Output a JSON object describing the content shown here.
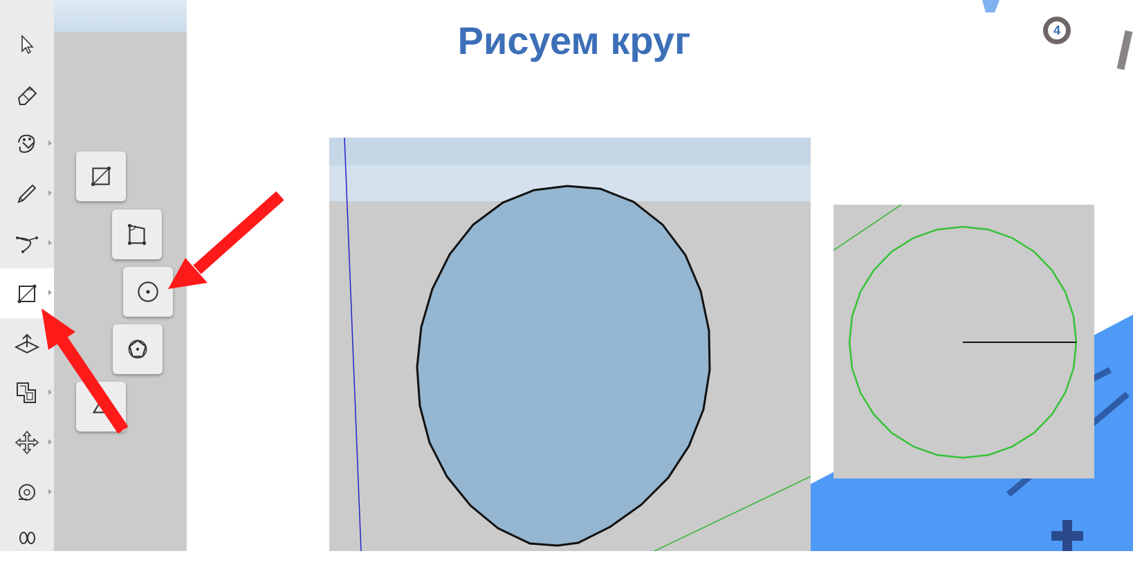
{
  "slide": {
    "title": "Рисуем круг",
    "number": "4"
  },
  "toolbar": {
    "tools": [
      {
        "name": "select-tool",
        "icon": "cursor-arrow-icon"
      },
      {
        "name": "eraser-tool",
        "icon": "eraser-icon"
      },
      {
        "name": "paint-bucket-tool",
        "icon": "paint-bucket-icon"
      },
      {
        "name": "pencil-tool",
        "icon": "pencil-icon"
      },
      {
        "name": "arc-tool",
        "icon": "arc-icon"
      },
      {
        "name": "rectangle-tool",
        "icon": "rectangle-icon",
        "active": true
      },
      {
        "name": "push-pull-tool",
        "icon": "push-pull-icon"
      },
      {
        "name": "offset-tool",
        "icon": "offset-icon"
      },
      {
        "name": "move-tool",
        "icon": "move-icon"
      },
      {
        "name": "tape-measure-tool",
        "icon": "tape-measure-icon"
      },
      {
        "name": "footprints-tool",
        "icon": "footprints-icon"
      }
    ]
  },
  "flyout": {
    "items": [
      {
        "name": "rectangle",
        "icon": "rectangle-icon"
      },
      {
        "name": "rotated-rectangle",
        "icon": "rotated-rectangle-icon"
      },
      {
        "name": "circle",
        "icon": "circle-icon"
      },
      {
        "name": "polygon",
        "icon": "polygon-icon"
      }
    ]
  },
  "colors": {
    "title": "#3c6fb8",
    "arrow": "#ff1a1a",
    "circle_fill": "#95b6d0",
    "viewport": "#cbcbcb",
    "green_axis": "#2fb52f",
    "blue_axis": "#2323c8",
    "deco_blue": "#4f9af7"
  }
}
